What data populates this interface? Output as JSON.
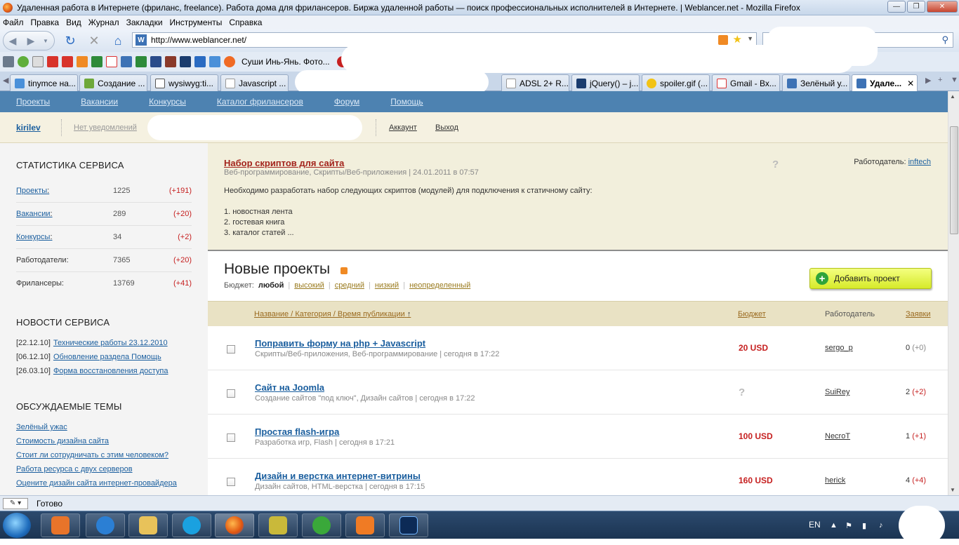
{
  "window": {
    "title": "Удаленная работа в Интернете (фриланс, freelance). Работа дома для фрилансеров. Биржа удаленной работы — поиск профессиональных исполнителей в Интернете. | Weblancer.net - Mozilla Firefox",
    "min": "—",
    "max": "❐",
    "close": "✕"
  },
  "menu": [
    "Файл",
    "Правка",
    "Вид",
    "Журнал",
    "Закладки",
    "Инструменты",
    "Справка"
  ],
  "navbar": {
    "url": "http://www.weblancer.net/",
    "site_icon": "W"
  },
  "bookmarks": {
    "label": "Суши Инь-Янь. Фото..."
  },
  "tabs": [
    {
      "label": "tinymce на...",
      "color": "#4a90d9"
    },
    {
      "label": "Создание ...",
      "color": "#6ea83a"
    },
    {
      "label": "wysiwyg:ti...",
      "color": "#ffffff"
    },
    {
      "label": "Javascript ...",
      "color": "#ffffff"
    },
    {
      "label": "ADSL 2+ R...",
      "color": "#ffffff"
    },
    {
      "label": "jQuery() – j...",
      "color": "#1a3c6e"
    },
    {
      "label": "spoiler.gif (...",
      "color": "#f2c316"
    },
    {
      "label": "Gmail - Вх...",
      "color": "#d33"
    },
    {
      "label": "Зелёный у...",
      "color": "#3d72b5"
    },
    {
      "label": "Удале...",
      "color": "#3d72b5"
    }
  ],
  "site": {
    "nav": [
      "Проекты",
      "Вакансии",
      "Конкурсы",
      "Каталог фрилансеров",
      "Форум",
      "Помощь"
    ],
    "user": "kirilev",
    "notifications": "Нет уведомлений",
    "account": "Аккаунт",
    "logout": "Выход"
  },
  "sidebar": {
    "stats_title": "СТАТИСТИКА СЕРВИСА",
    "stats": [
      {
        "label": "Проекты",
        "suffix": ":",
        "value": "1225",
        "delta": "(+191)",
        "link": true
      },
      {
        "label": "Вакансии",
        "suffix": ":",
        "value": "289",
        "delta": "(+20)",
        "link": true
      },
      {
        "label": "Конкурсы",
        "suffix": ":",
        "value": "34",
        "delta": "(+2)",
        "link": true
      },
      {
        "label": "Работодатели:",
        "suffix": "",
        "value": "7365",
        "delta": "(+20)",
        "link": false
      },
      {
        "label": "Фрилансеры:",
        "suffix": "",
        "value": "13769",
        "delta": "(+41)",
        "link": false
      }
    ],
    "news_title": "НОВОСТИ СЕРВИСА",
    "news": [
      {
        "date": "[22.12.10]",
        "text": "Технические работы 23.12.2010"
      },
      {
        "date": "[06.12.10]",
        "text": "Обновление раздела Помощь"
      },
      {
        "date": "[26.03.10]",
        "text": "Форма восстановления доступа"
      }
    ],
    "topics_title": "ОБСУЖДАЕМЫЕ ТЕМЫ",
    "topics": [
      "Зелёный ужас",
      "Стоимость дизайна сайта",
      "Стоит ли сотрудничать с этим человеком?",
      "Работа ресурса с двух серверов",
      "Оцените дизайн сайта интернет-провайдера"
    ]
  },
  "featured": {
    "title": "Набор скриптов для сайта",
    "meta": "Веб-программирование, Скрипты/Веб-приложения | 24.01.2011 в 07:57",
    "qmark": "?",
    "employer_label": "Работодатель:",
    "employer": "inftech",
    "desc": "Необходимо разработать набор следующих скриптов (модулей) для подключения к статичному сайту:",
    "items": [
      "1. новостная лента",
      "2. гостевая книга",
      "3. каталог статей ..."
    ]
  },
  "projects_section": {
    "title": "Новые проекты",
    "budget_label": "Бюджет:",
    "filters": [
      "любой",
      "высокий",
      "средний",
      "низкий",
      "неопределенный"
    ],
    "add_button": "Добавить проект",
    "add_icon": "+",
    "col_title": "Название / Категория / Время публикации",
    "sort_arrow": "↑",
    "col_budget": "Бюджет",
    "col_employer": "Работодатель",
    "col_bids": "Заявки"
  },
  "projects": [
    {
      "title": "Поправить форму на php + Javascript",
      "meta": "Скрипты/Веб-приложения, Веб-программирование | сегодня в 17:22",
      "budget": "20 USD",
      "employer": "sergo_p",
      "bids": "0",
      "bids_delta": "(+0)"
    },
    {
      "title": "Сайт на Joomla",
      "meta": "Создание сайтов \"под ключ\", Дизайн сайтов | сегодня в 17:22",
      "budget": "?",
      "employer": "SuiRey",
      "bids": "2",
      "bids_delta": "(+2)"
    },
    {
      "title": "Простая flash-игра",
      "meta": "Разработка игр, Flash | сегодня в 17:21",
      "budget": "100 USD",
      "employer": "NecroT",
      "bids": "1",
      "bids_delta": "(+1)"
    },
    {
      "title": "Дизайн и верстка интернет-витрины",
      "meta": "Дизайн сайтов, HTML-верстка | сегодня в 17:15",
      "budget": "160 USD",
      "employer": "herick",
      "bids": "4",
      "bids_delta": "(+4)"
    }
  ],
  "status": {
    "text": "Готово"
  },
  "taskbar": {
    "lang": "EN"
  }
}
